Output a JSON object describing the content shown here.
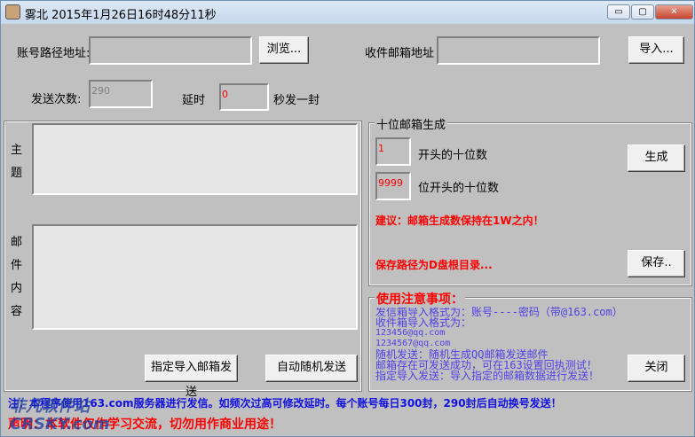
{
  "window": {
    "title": "雾北  2015年1月26日16时48分11秒",
    "minimize": "▭",
    "maximize": "▢",
    "close": "✕"
  },
  "top": {
    "account_path_label": "账号路径地址:",
    "account_path_value": "",
    "browse": "浏览...",
    "recipient_label": "收件邮箱地址",
    "recipient_value": "",
    "import": "导入...",
    "send_count_label": "发送次数:",
    "send_count_value": "290",
    "delay_label": "延时",
    "delay_value": "0",
    "delay_suffix": "秒发一封"
  },
  "compose": {
    "subject_label": "主题",
    "subject_value": "",
    "body_label": "邮件内容",
    "body_value": "",
    "import_send": "指定导入邮箱发送",
    "auto_send": "自动随机发送"
  },
  "generator": {
    "title": "十位邮箱生成",
    "prefix_value": "1",
    "prefix_label": "开头的十位数",
    "digits_value": "9999",
    "digits_label": "位开头的十位数",
    "generate": "生成",
    "advice": "建议：邮箱生成数保持在1W之内！",
    "save_path": "保存路径为D盘根目录...",
    "save": "保存.."
  },
  "notes": {
    "title": "使用注意事项：",
    "lines": [
      "发信箱导入格式为：账号----密码（带@163.com）",
      "收件箱导入格式为：",
      "123456@qq.com",
      "1234567@qq.com",
      "随机发送：随机生成QQ邮箱发送邮件",
      "邮箱存在可发送成功，可在163设置回执测试！",
      "指定导入发送：导入指定的邮箱数据进行发送！"
    ],
    "close": "关闭"
  },
  "footer": {
    "note": "注：本程序使用163.com服务器进行发信。如频次过高可修改延时。每个账号每日300封，290封后自动换号发送！",
    "disclaimer": "声明：本软件仅作学习交流，切勿用作商业用途！",
    "watermark": "非凡软件站 CRSKY.com"
  },
  "colors": {
    "background": "#c0c0c0",
    "note_text": "#5040e8",
    "warning": "#ff0000",
    "footer_note": "#1010e0"
  }
}
